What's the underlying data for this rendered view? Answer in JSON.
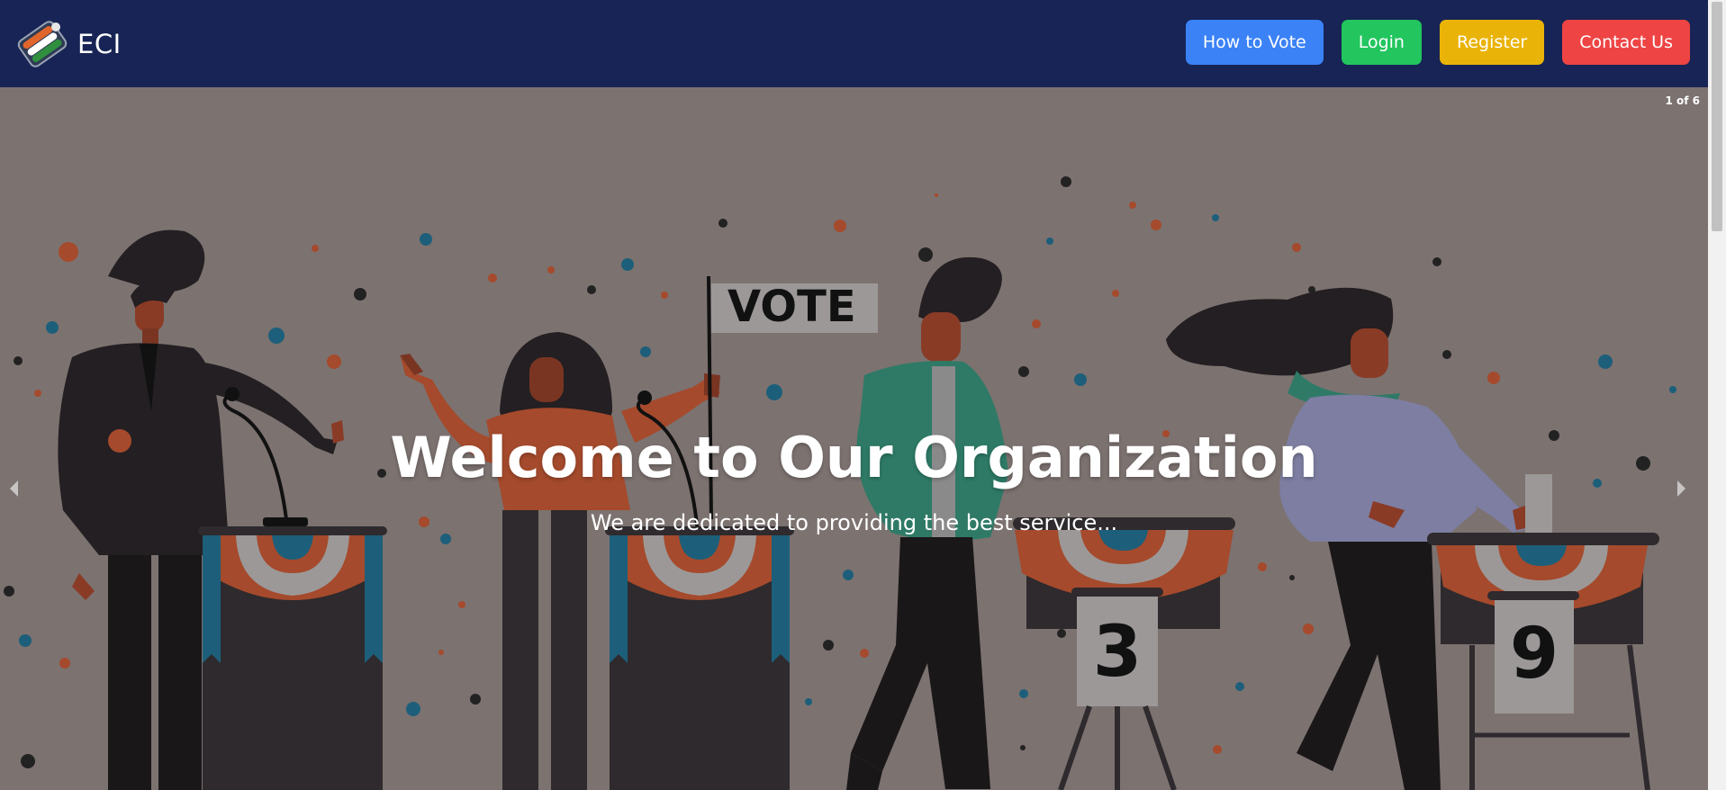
{
  "header": {
    "brand_text": "ECI",
    "logo_icon": "ballot-stripes-logo-icon",
    "nav": {
      "how_to_vote": "How to Vote",
      "login": "Login",
      "register": "Register",
      "contact_us": "Contact Us"
    }
  },
  "hero": {
    "slide_counter": "1 of 6",
    "title": "Welcome to Our Organization",
    "subtitle": "We are dedicated to providing the best service...",
    "sign_text": "VOTE",
    "podium_number_1": "3",
    "podium_number_2": "9",
    "prev_icon": "chevron-left-icon",
    "next_icon": "chevron-right-icon"
  },
  "colors": {
    "navbar": "#172455",
    "hero_bg": "#7c7270",
    "how_to_vote": "#3b82f6",
    "login": "#22c55e",
    "register": "#eab308",
    "contact_us": "#ef4444"
  }
}
